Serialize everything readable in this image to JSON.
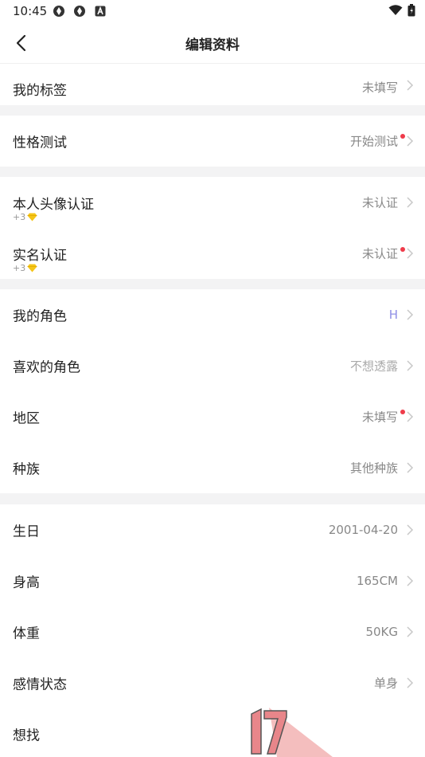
{
  "status_bar": {
    "time": "10:45",
    "left_icons": [
      "app-icon",
      "app-icon",
      "notification-a-icon"
    ],
    "right_icons": [
      "wifi-icon",
      "battery-icon"
    ]
  },
  "nav": {
    "title": "编辑资料",
    "back_icon": "chevron-left-icon"
  },
  "rows": {
    "tags": {
      "label": "我的标签",
      "value": "未填写"
    },
    "personality_test": {
      "label": "性格测试",
      "value": "开始测试"
    },
    "avatar_verify": {
      "label": "本人头像认证",
      "sub": "+3",
      "value": "未认证"
    },
    "realname_verify": {
      "label": "实名认证",
      "sub": "+3",
      "value": "未认证"
    },
    "my_role": {
      "label": "我的角色",
      "value": "H"
    },
    "liked_role": {
      "label": "喜欢的角色",
      "value": "不想透露"
    },
    "region": {
      "label": "地区",
      "value": "未填写"
    },
    "race": {
      "label": "种族",
      "value": "其他种族"
    },
    "birthday": {
      "label": "生日",
      "value": "2001-04-20"
    },
    "height": {
      "label": "身高",
      "value": "165CM"
    },
    "weight": {
      "label": "体重",
      "value": "50KG"
    },
    "relationship": {
      "label": "感情状态",
      "value": "单身"
    },
    "looking_for": {
      "label": "想找",
      "value": ""
    }
  },
  "watermark": {
    "text": "17"
  },
  "colors": {
    "accent_dot": "#ef3b4a",
    "role_value": "#8f8fe6",
    "gem": "#f5c518",
    "separator": "#f3f3f4"
  }
}
